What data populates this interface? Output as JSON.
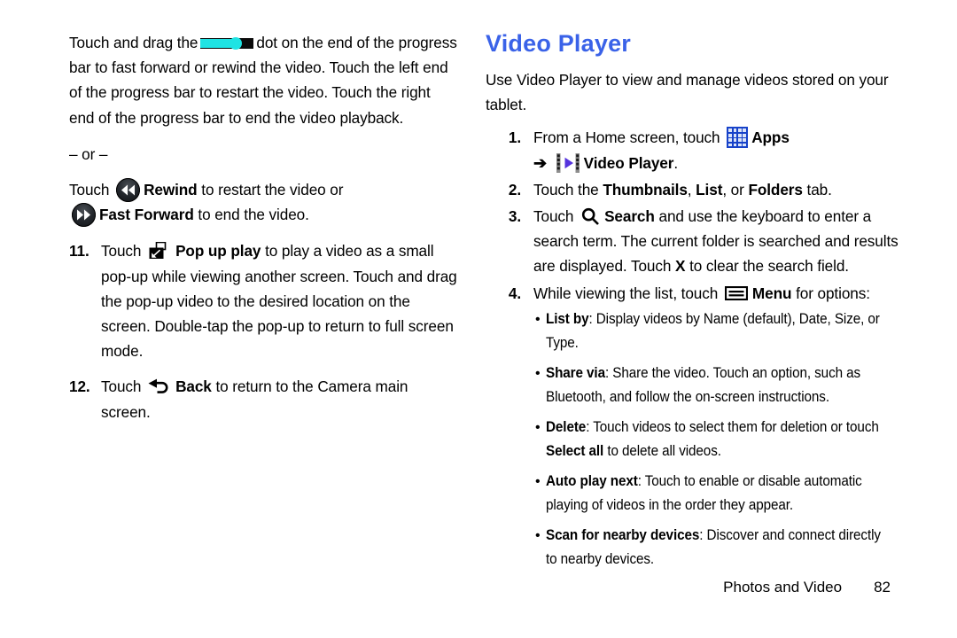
{
  "left_column": {
    "para1": {
      "before_icon": "Touch and drag the",
      "icon": "progress-bar-icon",
      "after_icon": "dot on the end of the progress bar to fast forward or rewind the video. Touch the left end of the progress bar to restart the video. Touch the right end of the progress bar to end the video playback."
    },
    "or_separator": "– or –",
    "para2": {
      "t1": "Touch",
      "icon1": "rewind-icon",
      "bold1": "Rewind",
      "t2": "to restart the video or",
      "icon2": "fast-forward-icon",
      "bold2": "Fast Forward",
      "t3": "to end the video."
    },
    "steps": [
      {
        "number": "11.",
        "t1": "Touch",
        "icon": "pop-up-play-icon",
        "bold": "Pop up play",
        "t2": "to play a video as a small pop-up while viewing another screen. Touch and drag the pop-up video to the desired location on the screen. Double-tap the pop-up to return to full screen mode."
      },
      {
        "number": "12.",
        "t1": "Touch",
        "icon": "back-icon",
        "bold": "Back",
        "t2": "to return to the Camera main screen."
      }
    ]
  },
  "right_column": {
    "title": "Video Player",
    "intro": "Use Video Player to view and manage videos stored on your tablet.",
    "steps": [
      {
        "number": "1.",
        "t1": "From a Home screen, touch",
        "icon1": "apps-grid-icon",
        "bold1": "Apps",
        "arrow": "➔",
        "icon2": "video-player-film-icon",
        "bold2": "Video Player",
        "t2": "."
      },
      {
        "number": "2.",
        "t1": "Touch the",
        "bold1": "Thumbnails",
        "sep1": ",",
        "bold2": "List",
        "sep2": ", or",
        "bold3": "Folders",
        "t2": "tab."
      },
      {
        "number": "3.",
        "t1": "Touch",
        "icon": "search-icon",
        "bold1": "Search",
        "t2": "and use the keyboard to enter a search term. The current folder is searched and results are displayed. Touch",
        "bold2": "X",
        "t3": "to clear the search field."
      },
      {
        "number": "4.",
        "t1": "While viewing the list, touch",
        "icon": "menu-icon",
        "bold1": "Menu",
        "t2": "for options:"
      }
    ],
    "options": [
      {
        "bullet": "•",
        "label": "List by",
        "text": ": Display videos by Name (default), Date, Size, or Type."
      },
      {
        "bullet": "•",
        "label": "Share via",
        "text": ": Share the video. Touch an option, such as Bluetooth, and follow the on-screen instructions."
      },
      {
        "bullet": "•",
        "label": "Delete",
        "text": ": Touch videos to select them for deletion or touch ",
        "label2": "Select all",
        "text2": " to delete all videos."
      },
      {
        "bullet": "•",
        "label": "Auto play next",
        "text": ": Touch to enable or disable automatic playing of videos in the order they appear."
      },
      {
        "bullet": "•",
        "label": "Scan for nearby devices",
        "text": ": Discover and connect directly to nearby devices."
      }
    ]
  },
  "footer": {
    "chapter": "Photos and Video",
    "page_number": "82"
  },
  "colors": {
    "heading": "#3a62e8",
    "progress_fill": "#1fe3e3",
    "apps_icon": "#1742c9",
    "text": "#000000"
  }
}
